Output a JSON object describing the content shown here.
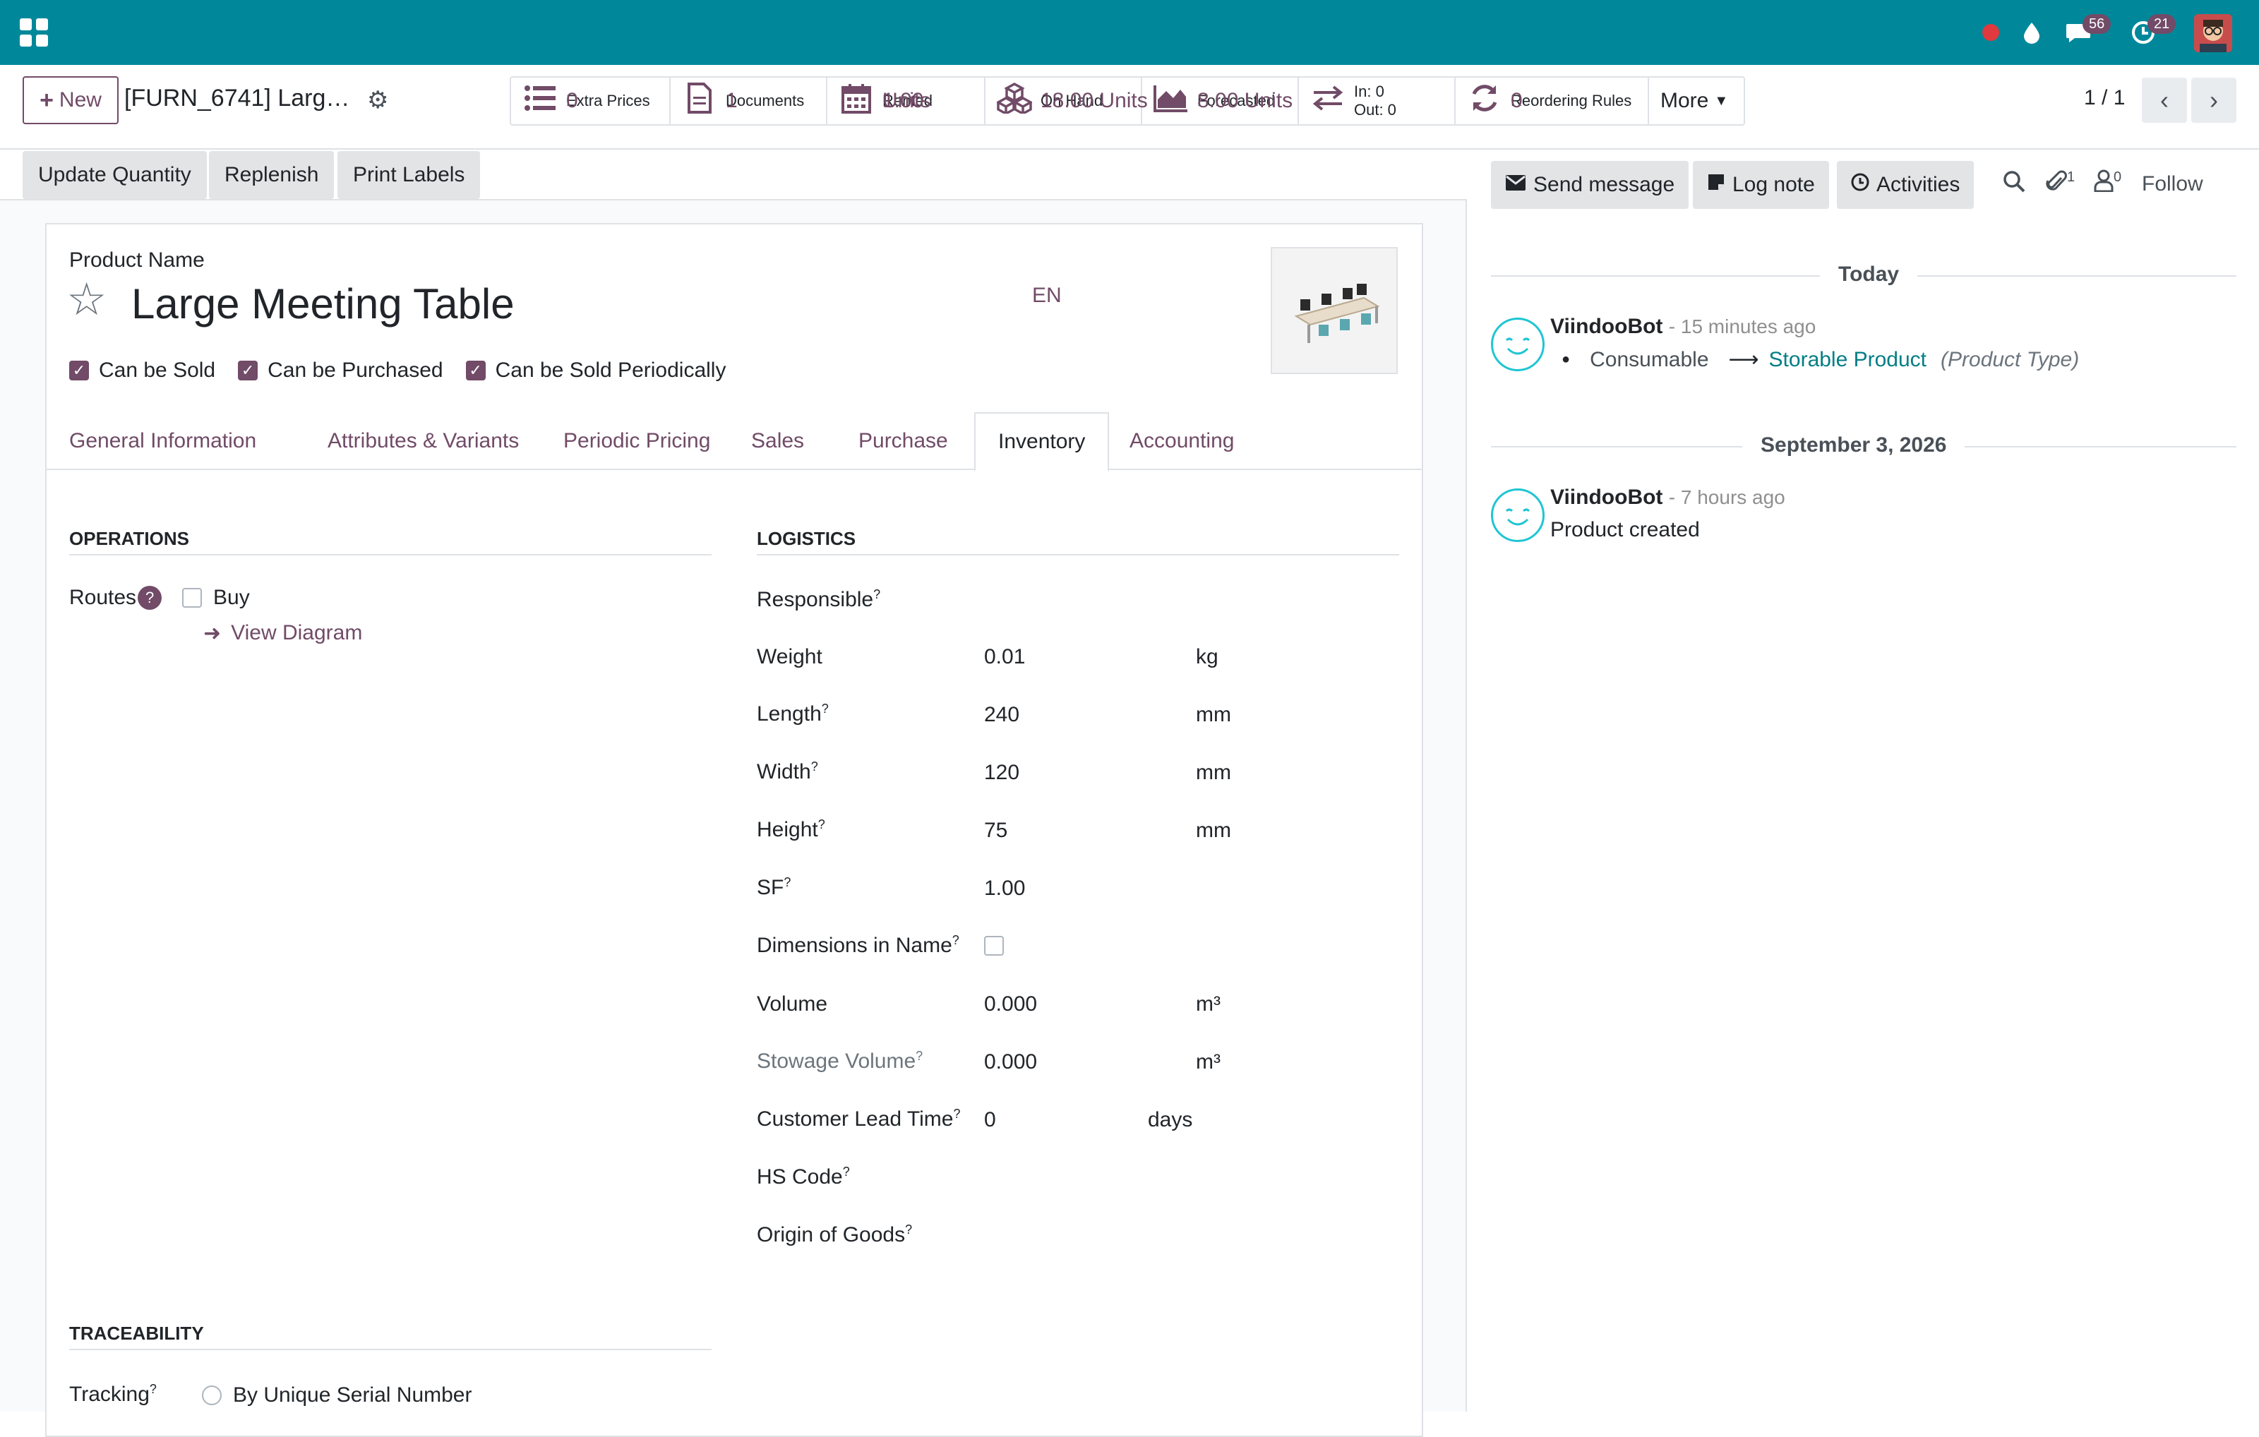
{
  "topbar": {
    "messages_count": "56",
    "activities_count": "21"
  },
  "control_panel": {
    "new_label": "New",
    "breadcrumb": "[FURN_6741] Larg…",
    "pager": "1 / 1",
    "smart_buttons": [
      {
        "label": "Extra Prices",
        "value": "0",
        "icon": "list-icon"
      },
      {
        "label": "Documents",
        "value": "1",
        "icon": "document-icon"
      },
      {
        "label": "Rented",
        "value": "1.00",
        "value2": "Units",
        "icon": "calendar-icon"
      },
      {
        "label": "On Hand",
        "value": "18.00 Units",
        "icon": "cubes-icon"
      },
      {
        "label": "Forecasted",
        "value": "8.00 Units",
        "icon": "area-chart-icon"
      },
      {
        "label": "In: 0",
        "value": "Out: 0",
        "icon": "exchange-icon"
      },
      {
        "label": "Reordering Rules",
        "value": "0",
        "icon": "refresh-icon"
      }
    ],
    "more_label": "More"
  },
  "statusbar": {
    "update_quantity": "Update Quantity",
    "replenish": "Replenish",
    "print_labels": "Print Labels"
  },
  "form": {
    "product_name_label": "Product Name",
    "product_name": "Large Meeting Table",
    "lang": "EN",
    "checks": [
      {
        "label": "Can be Sold",
        "checked": true
      },
      {
        "label": "Can be Purchased",
        "checked": true
      },
      {
        "label": "Can be Sold Periodically",
        "checked": true
      }
    ],
    "tabs": [
      "General Information",
      "Attributes & Variants",
      "Periodic Pricing",
      "Sales",
      "Purchase",
      "Inventory",
      "Accounting"
    ],
    "active_tab": "Inventory",
    "operations": {
      "title": "OPERATIONS",
      "routes_label": "Routes",
      "buy_label": "Buy",
      "view_diagram": "View Diagram"
    },
    "logistics": {
      "title": "LOGISTICS",
      "responsible": "Responsible",
      "weight": {
        "label": "Weight",
        "value": "0.01",
        "unit": "kg"
      },
      "length": {
        "label": "Length",
        "value": "240",
        "unit": "mm"
      },
      "width": {
        "label": "Width",
        "value": "120",
        "unit": "mm"
      },
      "height": {
        "label": "Height",
        "value": "75",
        "unit": "mm"
      },
      "sf": {
        "label": "SF",
        "value": "1.00"
      },
      "dims_in_name": "Dimensions in Name",
      "volume": {
        "label": "Volume",
        "value": "0.000",
        "unit": "m³"
      },
      "stowage_volume": {
        "label": "Stowage Volume",
        "value": "0.000",
        "unit": "m³"
      },
      "lead_time": {
        "label": "Customer Lead Time",
        "value": "0",
        "unit": "days"
      },
      "hs_code": "HS Code",
      "origin": "Origin of Goods"
    },
    "traceability": {
      "title": "TRACEABILITY",
      "tracking_label": "Tracking",
      "option": "By Unique Serial Number"
    }
  },
  "chatter": {
    "send_message": "Send message",
    "log_note": "Log note",
    "activities": "Activities",
    "attachments_count": "1",
    "followers_count": "0",
    "follow": "Follow",
    "groups": [
      {
        "date": "Today",
        "author": "ViindooBot",
        "time": "- 15 minutes ago",
        "old_value": "Consumable",
        "new_value": "Storable Product",
        "field": "(Product Type)"
      },
      {
        "date": "September 3, 2026",
        "author": "ViindooBot",
        "time": "- 7 hours ago",
        "body": "Product created"
      }
    ]
  },
  "colors": {
    "topbar": "#00889a",
    "brand": "#714b67",
    "link": "#017e84"
  }
}
